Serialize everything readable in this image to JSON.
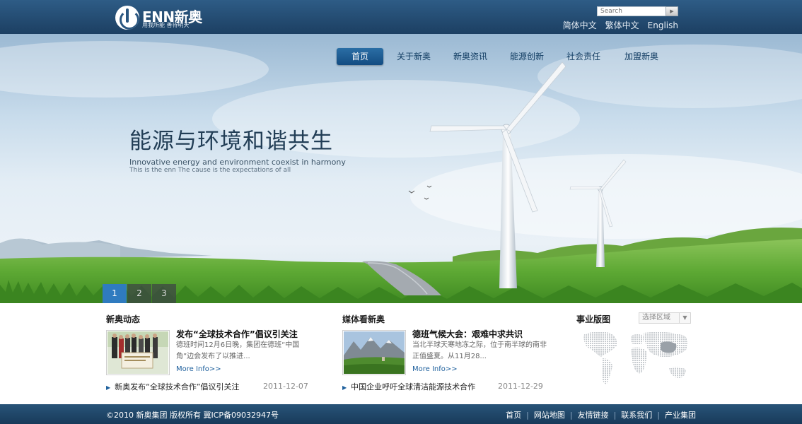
{
  "header": {
    "logo": {
      "name": "ENN新奥",
      "slogan": "用我所能  善待明天"
    },
    "search": {
      "placeholder": "Search",
      "button_icon": "search-arrow-icon"
    },
    "languages": [
      "简体中文",
      "繁体中文",
      "English"
    ]
  },
  "nav": {
    "items": [
      {
        "label": "首页",
        "active": true
      },
      {
        "label": "关于新奥",
        "active": false
      },
      {
        "label": "新奥资讯",
        "active": false
      },
      {
        "label": "能源创新",
        "active": false
      },
      {
        "label": "社会责任",
        "active": false
      },
      {
        "label": "加盟新奥",
        "active": false
      }
    ]
  },
  "hero": {
    "headline": "能源与环境和谐共生",
    "subtitle": "Innovative energy and environment coexist in harmony",
    "subtext": "This is the enn The cause is the expectations of all",
    "slides": [
      "1",
      "2",
      "3"
    ],
    "active_slide": 0
  },
  "news": {
    "title": "新奥动态",
    "feature": {
      "title": "发布“全球技术合作”倡议引关注",
      "desc": "德班时间12月6日晚，集团在德班“中国角”边会发布了以推进...",
      "more": "More Info>>"
    },
    "item": {
      "text": "新奥发布“全球技术合作”倡议引关注",
      "date": "2011-12-07"
    }
  },
  "media": {
    "title": "媒体看新奥",
    "feature": {
      "title": "德班气候大会：艰难中求共识",
      "desc": "当北半球天寒地冻之际，位于南半球的南非正值盛夏。从11月28...",
      "more": "More Info>>"
    },
    "item": {
      "text": "中国企业呼吁全球清洁能源技术合作",
      "date": "2011-12-29"
    }
  },
  "business": {
    "title": "事业版图",
    "select_value": "选择区域"
  },
  "footer": {
    "copyright": "©2010 新奥集团 版权所有 冀ICP备09032947号",
    "links": [
      "首页",
      "网站地图",
      "友情链接",
      "联系我们",
      "产业集团"
    ]
  },
  "colors": {
    "header_bg": "#1f4568",
    "nav_active": "#1d5d95",
    "link_blue": "#1d5f9c",
    "footer_bg": "#1f4568"
  }
}
